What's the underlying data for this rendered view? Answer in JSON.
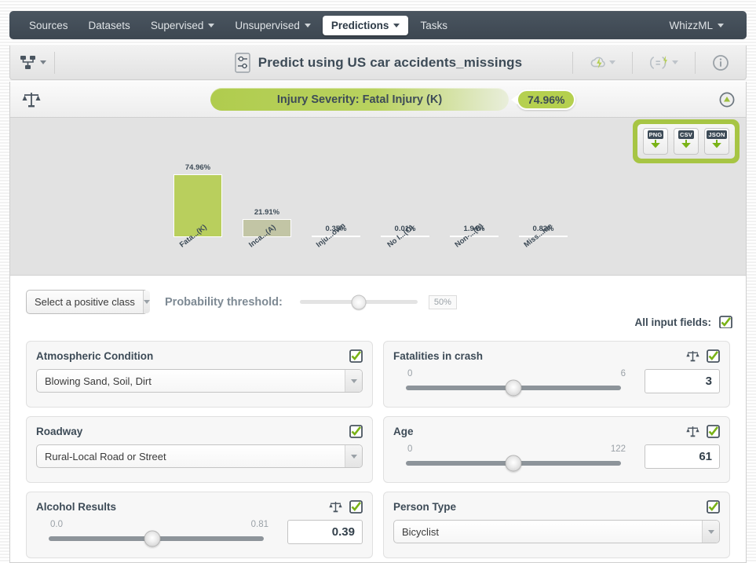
{
  "nav": {
    "items": [
      {
        "label": "Sources",
        "caret": false,
        "active": false
      },
      {
        "label": "Datasets",
        "caret": false,
        "active": false
      },
      {
        "label": "Supervised",
        "caret": true,
        "active": false
      },
      {
        "label": "Unsupervised",
        "caret": true,
        "active": false
      },
      {
        "label": "Predictions",
        "caret": true,
        "active": true
      },
      {
        "label": "Tasks",
        "caret": false,
        "active": false
      }
    ],
    "right": {
      "label": "WhizzML",
      "caret": true
    }
  },
  "toolbar": {
    "model_icon": "decision-tree-icon",
    "title_icon": "prediction-sliders-icon",
    "title": "Predict using US car accidents_missings",
    "action_icons": [
      "cloud-lightning-icon",
      "batch-prediction-icon",
      "info-icon"
    ]
  },
  "prediction": {
    "balance_icon": "scales-icon",
    "objective_label": "Injury Severity: Fatal Injury (K)",
    "confidence": "74.96%",
    "collapse_icon": "collapse-up-icon"
  },
  "exports": [
    {
      "label": "PNG",
      "name": "export-png-button"
    },
    {
      "label": "CSV",
      "name": "export-csv-button"
    },
    {
      "label": "JSON",
      "name": "export-json-button"
    }
  ],
  "chart_data": {
    "type": "bar",
    "title": "",
    "xlabel": "",
    "ylabel": "",
    "ylim": [
      0,
      100
    ],
    "grid": false,
    "legend": null,
    "categories": [
      "Fata...(K)",
      "Inca...(A)",
      "Inju...own",
      "No I...(O)",
      "Non-...(B)",
      "Miss...lue"
    ],
    "values": [
      74.96,
      21.91,
      0.35,
      0.01,
      1.94,
      0.83
    ],
    "value_labels": [
      "74.96%",
      "21.91%",
      "0.35%",
      "0.01%",
      "1.94%",
      "0.83%"
    ],
    "colors": [
      "#b9cf5d",
      "#c2c5a5",
      "#c2c5a5",
      "#c2c5a5",
      "#c2c5a5",
      "#c2c5a5"
    ]
  },
  "controls": {
    "positive_class": {
      "value": "Select a positive class",
      "arrow_icon": "chevron-down-icon"
    },
    "threshold_label": "Probability threshold:",
    "threshold_value": "50%",
    "threshold_pct": 50
  },
  "all_fields": {
    "label": "All input fields:",
    "checked_icon": "checkbox-checked-icon"
  },
  "fields": [
    {
      "name": "atmospheric-condition",
      "title": "Atmospheric Condition",
      "type": "select",
      "value": "Blowing Sand, Soil, Dirt",
      "has_balance": false,
      "checked": true
    },
    {
      "name": "fatalities-in-crash",
      "title": "Fatalities in crash",
      "type": "number",
      "min": "0",
      "max": "6",
      "value": "3",
      "knob_pct": 50,
      "has_balance": true,
      "checked": true
    },
    {
      "name": "roadway",
      "title": "Roadway",
      "type": "select",
      "value": "Rural-Local Road or Street",
      "has_balance": false,
      "checked": true
    },
    {
      "name": "age",
      "title": "Age",
      "type": "number",
      "min": "0",
      "max": "122",
      "value": "61",
      "knob_pct": 50,
      "has_balance": true,
      "checked": true
    },
    {
      "name": "alcohol-results",
      "title": "Alcohol Results",
      "type": "number",
      "min": "0.0",
      "max": "0.81",
      "value": "0.39",
      "knob_pct": 48,
      "has_balance": true,
      "checked": true
    },
    {
      "name": "person-type",
      "title": "Person Type",
      "type": "select",
      "value": "Bicyclist",
      "has_balance": false,
      "checked": true
    }
  ],
  "colors": {
    "accent_green": "#a7c544",
    "bar_primary": "#b9cf5d",
    "bar_secondary": "#c2c5a5",
    "nav_dark": "#3d4751",
    "text_dark": "#3d4b57"
  }
}
